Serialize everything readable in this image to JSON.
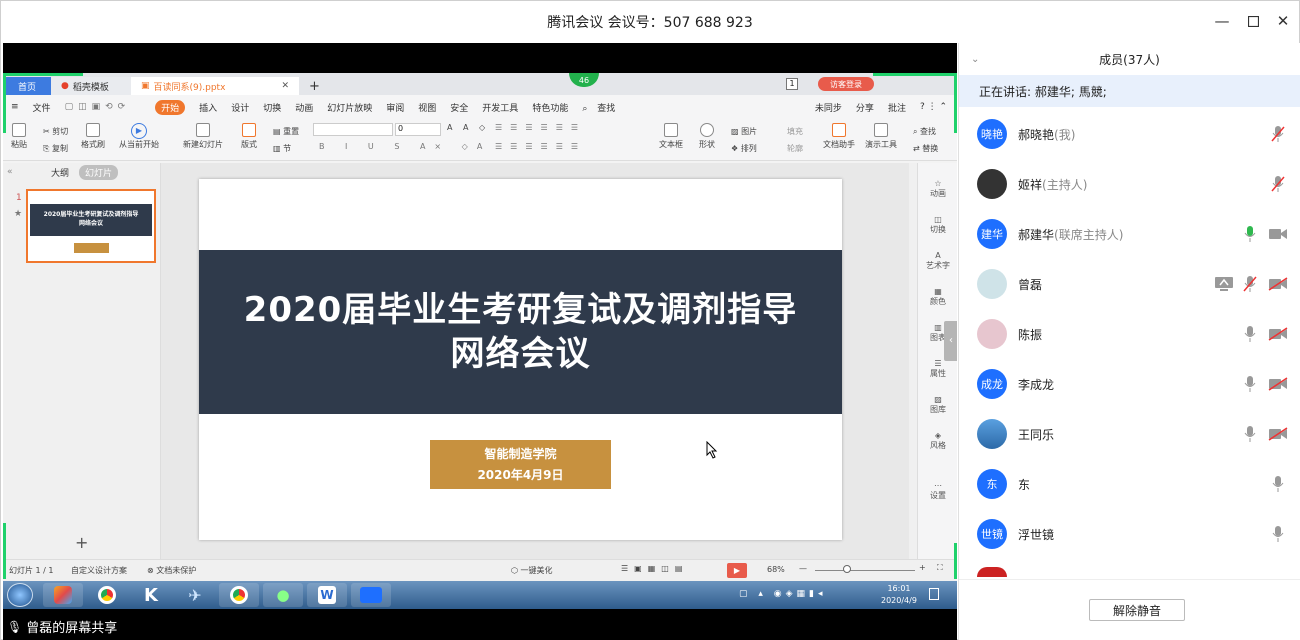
{
  "window": {
    "title": "腾讯会议 会议号：507 688 923"
  },
  "wps": {
    "tabs": [
      "首页",
      "稻壳模板",
      "百读同系(9).pptx"
    ],
    "login_label": "访客登录",
    "timer_badge": "46",
    "menu_left": "文件",
    "menu": [
      "开始",
      "插入",
      "设计",
      "切换",
      "动画",
      "幻灯片放映",
      "审阅",
      "视图",
      "安全",
      "开发工具",
      "特色功能",
      "查找"
    ],
    "menu_right": [
      "未同步",
      "分享",
      "批注"
    ],
    "ribbon": [
      "粘贴",
      "剪切",
      "复制",
      "格式刷",
      "从当前开始",
      "新建幻灯片",
      "版式",
      "重置",
      "节",
      "文本框",
      "形状",
      "图片",
      "排列",
      "填充",
      "轮廓",
      "文档助手",
      "演示工具",
      "查找",
      "替换"
    ],
    "font_size": "0",
    "outline_tabs": [
      "大纲",
      "幻灯片"
    ],
    "slide_num": "1",
    "right_tools": [
      "动画",
      "切换",
      "艺术字",
      "颜色",
      "图表",
      "属性",
      "图库",
      "风格",
      "设置"
    ],
    "slide": {
      "title_line1": "2020届毕业生考研复试及调剂指导",
      "title_line2": "网络会议",
      "box_line1": "智能制造学院",
      "box_line2": "2020年4月9日"
    },
    "status": {
      "slide_count": "幻灯片 1 / 1",
      "design": "自定义设计方案",
      "protect": "文档未保护",
      "beautify": "一键美化",
      "zoom": "68%"
    }
  },
  "taskbar": {
    "time": "16:01",
    "date": "2020/4/9"
  },
  "share_label": "曾磊的屏幕共享",
  "panel": {
    "header": "成员(37人)",
    "speaking": "正在讲话: 郝建华; 馬競;",
    "unmute_button": "解除静音",
    "members": [
      {
        "avatar": "晓艳",
        "name": "郝晓艳",
        "role": "(我)"
      },
      {
        "avatar": "",
        "name": "姬祥",
        "role": "(主持人)"
      },
      {
        "avatar": "建华",
        "name": "郝建华",
        "role": "(联席主持人)"
      },
      {
        "avatar": "",
        "name": "曾磊",
        "role": ""
      },
      {
        "avatar": "",
        "name": "陈振",
        "role": ""
      },
      {
        "avatar": "成龙",
        "name": "李成龙",
        "role": ""
      },
      {
        "avatar": "",
        "name": "王同乐",
        "role": ""
      },
      {
        "avatar": "东",
        "name": "东",
        "role": ""
      },
      {
        "avatar": "世镜",
        "name": "浮世镜",
        "role": ""
      }
    ]
  },
  "colors": {
    "accent": "#1e6fff",
    "share_border": "#1fd16b",
    "slide_band": "#2f3a4b",
    "slide_gold": "#c7913f",
    "wps_orange": "#f0772d"
  }
}
